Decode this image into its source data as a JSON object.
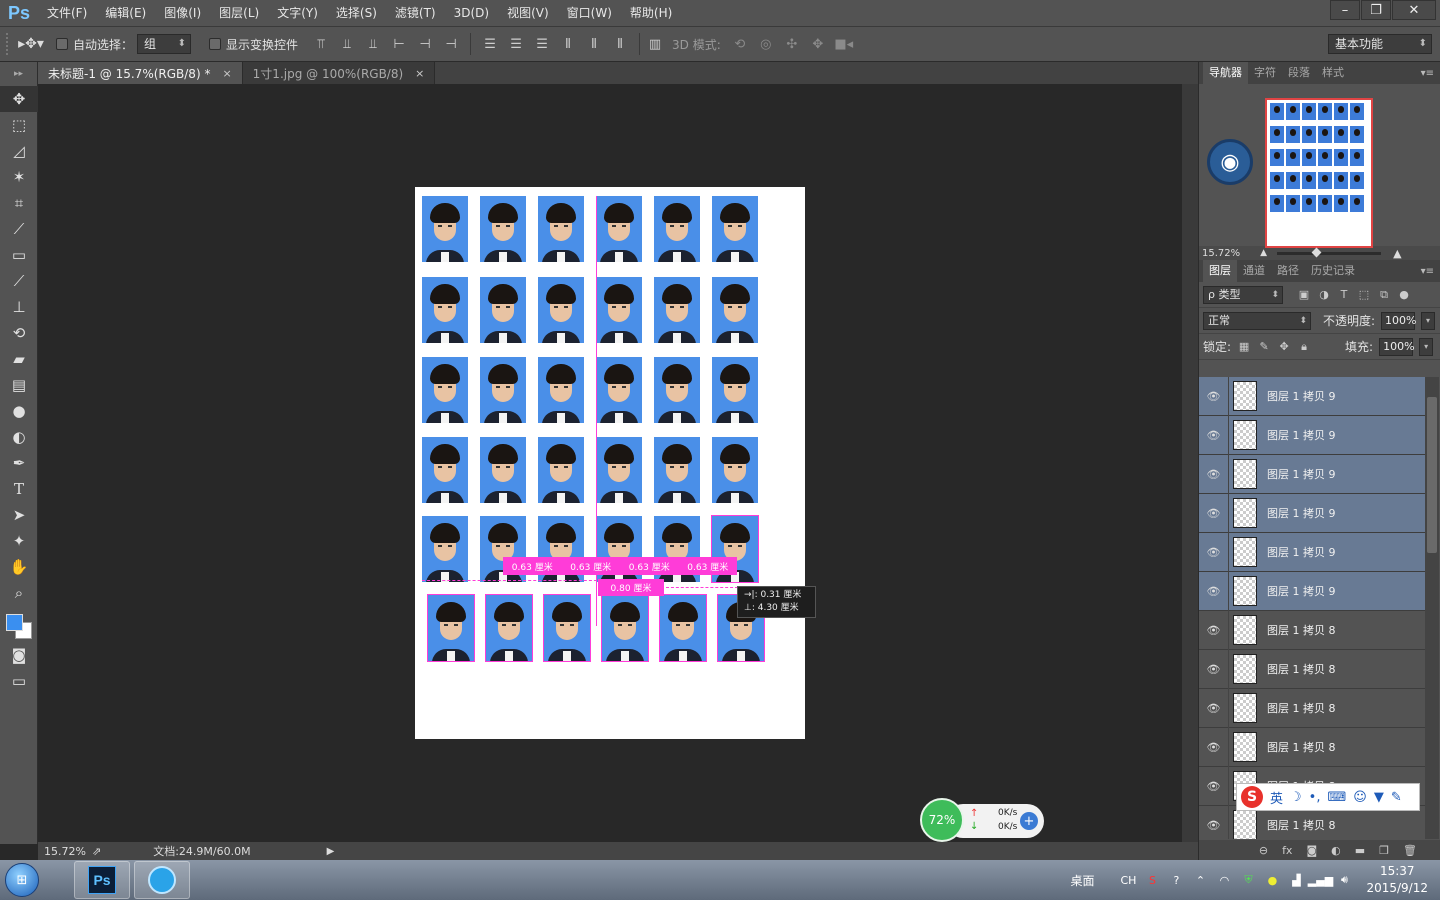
{
  "app": {
    "logo": "Ps"
  },
  "menu": [
    "文件(F)",
    "编辑(E)",
    "图像(I)",
    "图层(L)",
    "文字(Y)",
    "选择(S)",
    "滤镜(T)",
    "3D(D)",
    "视图(V)",
    "窗口(W)",
    "帮助(H)"
  ],
  "options": {
    "auto_select_label": "自动选择：",
    "auto_select_value": "组",
    "show_transform_label": "显示变换控件",
    "mode3d_label": "3D 模式:",
    "workspace": "基本功能"
  },
  "tabs": [
    {
      "label": "未标题-1 @ 15.7%(RGB/8) *",
      "active": true
    },
    {
      "label": "1寸1.jpg @ 100%(RGB/8)",
      "active": false
    }
  ],
  "canvas": {
    "measure_labels": [
      "0.63 厘米",
      "0.63 厘米",
      "0.63 厘米",
      "0.63 厘米"
    ],
    "measure_mid": "0.80 厘米",
    "tooltip_line1": "→|: 0.31 厘米",
    "tooltip_line2": "⊥: 4.30 厘米"
  },
  "status": {
    "zoom": "15.72%",
    "doc": "文档:24.9M/60.0M"
  },
  "navigator": {
    "tabs": [
      "导航器",
      "字符",
      "段落",
      "样式"
    ],
    "zoom": "15.72%"
  },
  "layers_panel": {
    "tabs": [
      "图层",
      "通道",
      "路径",
      "历史记录"
    ],
    "filter": "ρ 类型",
    "blend": "正常",
    "opacity_label": "不透明度:",
    "opacity": "100%",
    "lock_label": "锁定:",
    "fill_label": "填充:",
    "fill": "100%",
    "layers": [
      {
        "name": "图层 1 拷贝 9",
        "selected": true
      },
      {
        "name": "图层 1 拷贝 9",
        "selected": true
      },
      {
        "name": "图层 1 拷贝 9",
        "selected": true
      },
      {
        "name": "图层 1 拷贝 9",
        "selected": true
      },
      {
        "name": "图层 1 拷贝 9",
        "selected": true
      },
      {
        "name": "图层 1 拷贝 9",
        "selected": true
      },
      {
        "name": "图层 1 拷贝 8",
        "selected": false
      },
      {
        "name": "图层 1 拷贝 8",
        "selected": false
      },
      {
        "name": "图层 1 拷贝 8",
        "selected": false
      },
      {
        "name": "图层 1 拷贝 8",
        "selected": false
      },
      {
        "name": "图层 1 拷贝 8",
        "selected": false
      },
      {
        "name": "图层 1 拷贝 8",
        "selected": false
      }
    ]
  },
  "ime": {
    "mode": "英"
  },
  "net_widget": {
    "percent": "72%",
    "up": "0K/s",
    "down": "0K/s"
  },
  "taskbar": {
    "desktop": "桌面",
    "lang": "CH",
    "time": "15:37",
    "date": "2015/9/12"
  },
  "colors": {
    "foreground": "#3a8ff0",
    "background": "#ffffff",
    "guide": "#ff3cd8"
  }
}
